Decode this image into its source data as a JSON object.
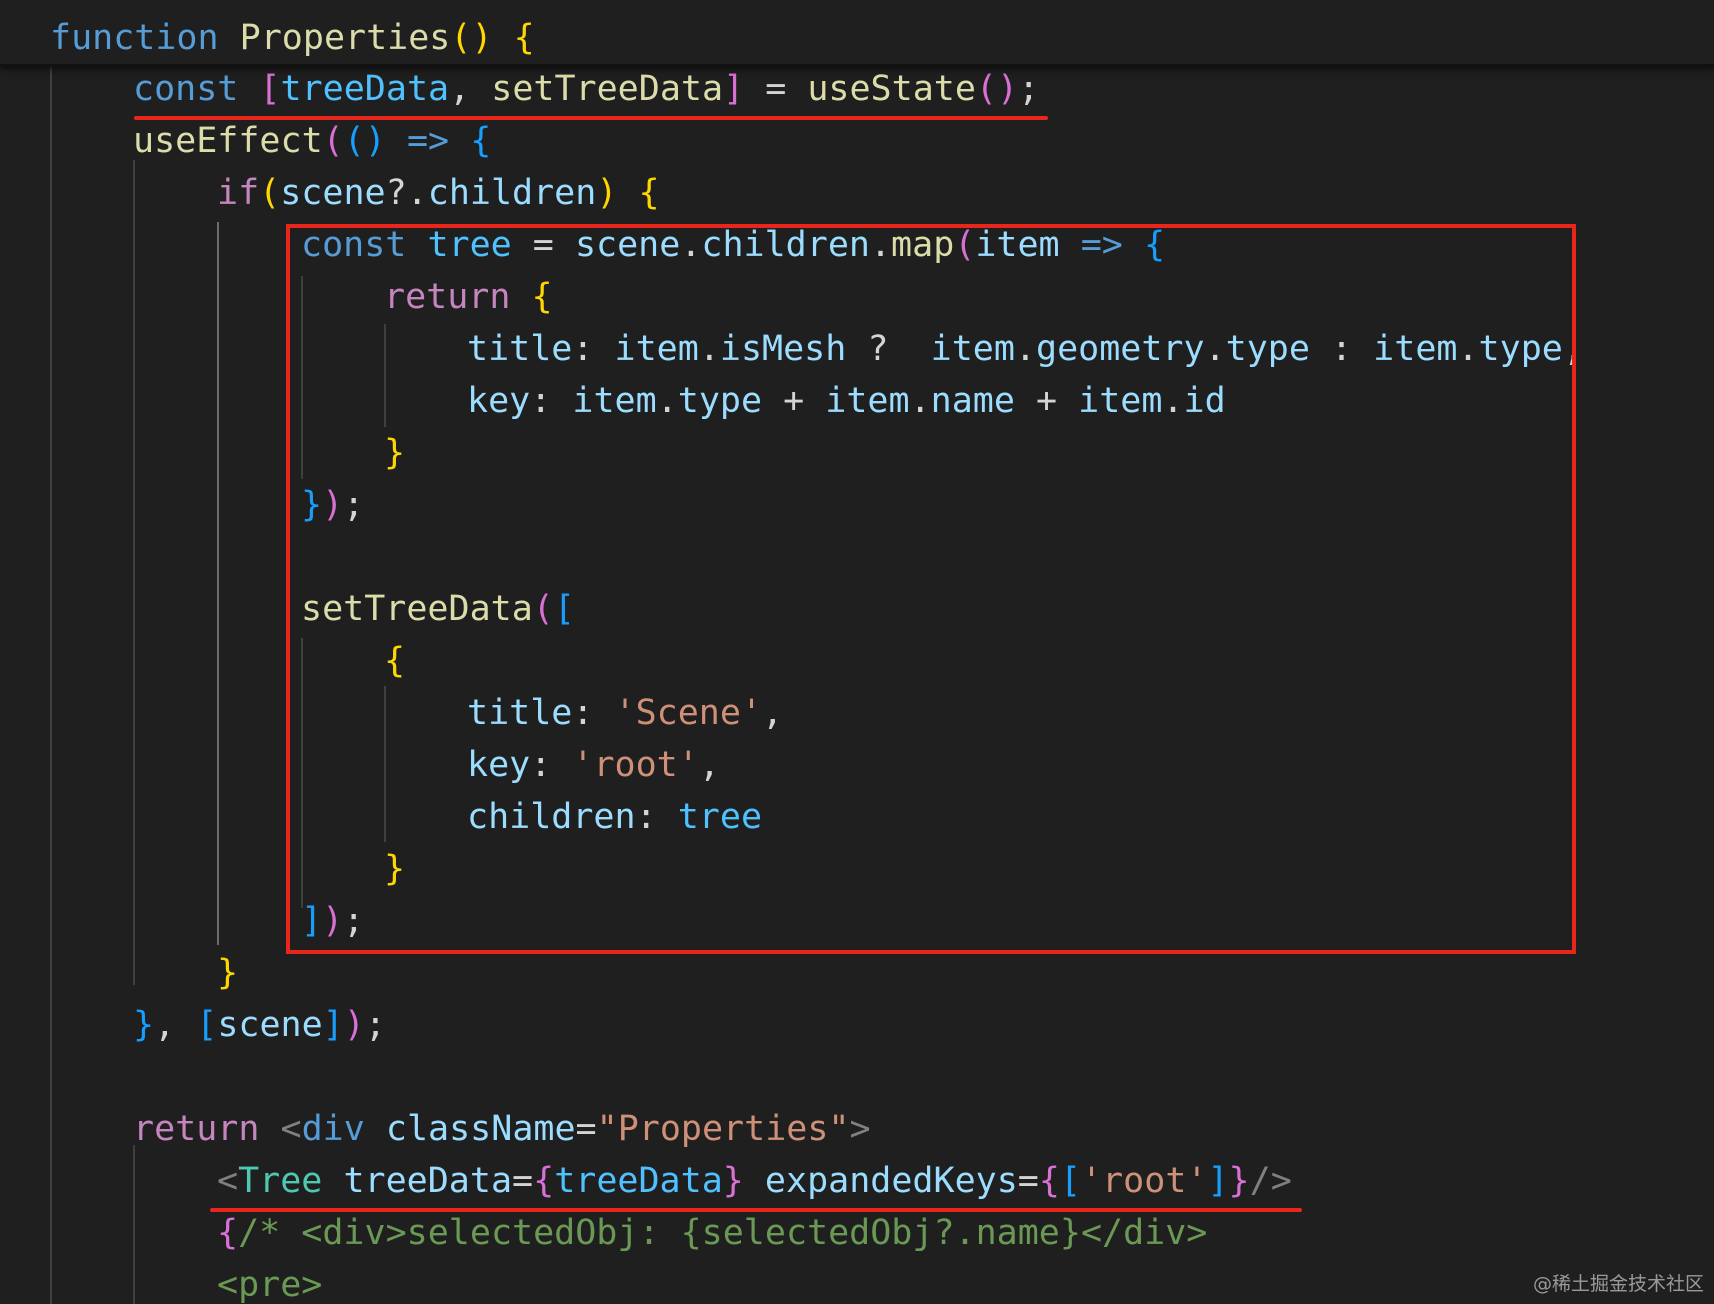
{
  "editor": {
    "theme": "dark",
    "colors": {
      "background": "#1f1f1f",
      "keyword": "#569cd6",
      "control": "#c586c0",
      "function": "#dcdcaa",
      "variable": "#9cdcfe",
      "constant": "#4fc1ff",
      "string": "#ce9178",
      "plain": "#d4d4d4",
      "bracket_1": "#ffd700",
      "bracket_2": "#da70d6",
      "bracket_3": "#179fff",
      "component_tag": "#4ec9b0",
      "html_tag": "#569cd6",
      "comment": "#6a9955",
      "annotation": "#e8261c"
    },
    "lines": [
      {
        "tokens": [
          {
            "t": "function",
            "c": "kw"
          },
          {
            "t": " ",
            "c": "pl"
          },
          {
            "t": "Properties",
            "c": "fn"
          },
          {
            "t": "()",
            "c": "b1"
          },
          {
            "t": " ",
            "c": "pl"
          },
          {
            "t": "{",
            "c": "b1"
          }
        ]
      },
      {
        "tokens": [
          {
            "t": "const",
            "c": "kw"
          },
          {
            "t": " ",
            "c": "pl"
          },
          {
            "t": "[",
            "c": "b2"
          },
          {
            "t": "treeData",
            "c": "cst"
          },
          {
            "t": ", ",
            "c": "pl"
          },
          {
            "t": "setTreeData",
            "c": "fn"
          },
          {
            "t": "]",
            "c": "b2"
          },
          {
            "t": " = ",
            "c": "pl"
          },
          {
            "t": "useState",
            "c": "fn"
          },
          {
            "t": "()",
            "c": "b2"
          },
          {
            "t": ";",
            "c": "pl"
          }
        ]
      },
      {
        "tokens": [
          {
            "t": "useEffect",
            "c": "fn"
          },
          {
            "t": "(",
            "c": "b2"
          },
          {
            "t": "()",
            "c": "b3"
          },
          {
            "t": " ",
            "c": "pl"
          },
          {
            "t": "=>",
            "c": "kw"
          },
          {
            "t": " ",
            "c": "pl"
          },
          {
            "t": "{",
            "c": "b3"
          }
        ]
      },
      {
        "tokens": [
          {
            "t": "if",
            "c": "ctl"
          },
          {
            "t": "(",
            "c": "b1"
          },
          {
            "t": "scene",
            "c": "var"
          },
          {
            "t": "?.",
            "c": "pl"
          },
          {
            "t": "children",
            "c": "var"
          },
          {
            "t": ")",
            "c": "b1"
          },
          {
            "t": " ",
            "c": "pl"
          },
          {
            "t": "{",
            "c": "b1"
          }
        ]
      },
      {
        "tokens": [
          {
            "t": "const",
            "c": "kw"
          },
          {
            "t": " ",
            "c": "pl"
          },
          {
            "t": "tree",
            "c": "cst"
          },
          {
            "t": " = ",
            "c": "pl"
          },
          {
            "t": "scene",
            "c": "var"
          },
          {
            "t": ".",
            "c": "pl"
          },
          {
            "t": "children",
            "c": "var"
          },
          {
            "t": ".",
            "c": "pl"
          },
          {
            "t": "map",
            "c": "fn"
          },
          {
            "t": "(",
            "c": "b2"
          },
          {
            "t": "item",
            "c": "var"
          },
          {
            "t": " ",
            "c": "pl"
          },
          {
            "t": "=>",
            "c": "kw"
          },
          {
            "t": " ",
            "c": "pl"
          },
          {
            "t": "{",
            "c": "b3"
          }
        ]
      },
      {
        "tokens": [
          {
            "t": "return",
            "c": "ctl"
          },
          {
            "t": " ",
            "c": "pl"
          },
          {
            "t": "{",
            "c": "b1"
          }
        ]
      },
      {
        "tokens": [
          {
            "t": "title",
            "c": "var"
          },
          {
            "t": ": ",
            "c": "pl"
          },
          {
            "t": "item",
            "c": "var"
          },
          {
            "t": ".",
            "c": "pl"
          },
          {
            "t": "isMesh",
            "c": "var"
          },
          {
            "t": " ?  ",
            "c": "pl"
          },
          {
            "t": "item",
            "c": "var"
          },
          {
            "t": ".",
            "c": "pl"
          },
          {
            "t": "geometry",
            "c": "var"
          },
          {
            "t": ".",
            "c": "pl"
          },
          {
            "t": "type",
            "c": "var"
          },
          {
            "t": " : ",
            "c": "pl"
          },
          {
            "t": "item",
            "c": "var"
          },
          {
            "t": ".",
            "c": "pl"
          },
          {
            "t": "type",
            "c": "var"
          },
          {
            "t": ",",
            "c": "pl"
          }
        ]
      },
      {
        "tokens": [
          {
            "t": "key",
            "c": "var"
          },
          {
            "t": ": ",
            "c": "pl"
          },
          {
            "t": "item",
            "c": "var"
          },
          {
            "t": ".",
            "c": "pl"
          },
          {
            "t": "type",
            "c": "var"
          },
          {
            "t": " + ",
            "c": "pl"
          },
          {
            "t": "item",
            "c": "var"
          },
          {
            "t": ".",
            "c": "pl"
          },
          {
            "t": "name",
            "c": "var"
          },
          {
            "t": " + ",
            "c": "pl"
          },
          {
            "t": "item",
            "c": "var"
          },
          {
            "t": ".",
            "c": "pl"
          },
          {
            "t": "id",
            "c": "var"
          }
        ]
      },
      {
        "tokens": [
          {
            "t": "}",
            "c": "b1"
          }
        ]
      },
      {
        "tokens": [
          {
            "t": "}",
            "c": "b3"
          },
          {
            "t": ")",
            "c": "b2"
          },
          {
            "t": ";",
            "c": "pl"
          }
        ]
      },
      {
        "tokens": []
      },
      {
        "tokens": [
          {
            "t": "setTreeData",
            "c": "fn"
          },
          {
            "t": "(",
            "c": "b2"
          },
          {
            "t": "[",
            "c": "b3"
          }
        ]
      },
      {
        "tokens": [
          {
            "t": "{",
            "c": "b1"
          }
        ]
      },
      {
        "tokens": [
          {
            "t": "title",
            "c": "var"
          },
          {
            "t": ": ",
            "c": "pl"
          },
          {
            "t": "'Scene'",
            "c": "str"
          },
          {
            "t": ",",
            "c": "pl"
          }
        ]
      },
      {
        "tokens": [
          {
            "t": "key",
            "c": "var"
          },
          {
            "t": ": ",
            "c": "pl"
          },
          {
            "t": "'root'",
            "c": "str"
          },
          {
            "t": ",",
            "c": "pl"
          }
        ]
      },
      {
        "tokens": [
          {
            "t": "children",
            "c": "var"
          },
          {
            "t": ": ",
            "c": "pl"
          },
          {
            "t": "tree",
            "c": "cst"
          }
        ]
      },
      {
        "tokens": [
          {
            "t": "}",
            "c": "b1"
          }
        ]
      },
      {
        "tokens": [
          {
            "t": "]",
            "c": "b3"
          },
          {
            "t": ")",
            "c": "b2"
          },
          {
            "t": ";",
            "c": "pl"
          }
        ]
      },
      {
        "tokens": [
          {
            "t": "}",
            "c": "b1"
          }
        ]
      },
      {
        "tokens": [
          {
            "t": "}",
            "c": "b3"
          },
          {
            "t": ", ",
            "c": "pl"
          },
          {
            "t": "[",
            "c": "b3"
          },
          {
            "t": "scene",
            "c": "var"
          },
          {
            "t": "]",
            "c": "b3"
          },
          {
            "t": ")",
            "c": "b2"
          },
          {
            "t": ";",
            "c": "pl"
          }
        ]
      },
      {
        "tokens": []
      },
      {
        "tokens": [
          {
            "t": "return",
            "c": "ctl"
          },
          {
            "t": " ",
            "c": "pl"
          },
          {
            "t": "<",
            "c": "ang"
          },
          {
            "t": "div",
            "c": "htm"
          },
          {
            "t": " ",
            "c": "pl"
          },
          {
            "t": "className",
            "c": "att"
          },
          {
            "t": "=",
            "c": "pl"
          },
          {
            "t": "\"Properties\"",
            "c": "str"
          },
          {
            "t": ">",
            "c": "ang"
          }
        ]
      },
      {
        "tokens": [
          {
            "t": "<",
            "c": "ang"
          },
          {
            "t": "Tree",
            "c": "tag"
          },
          {
            "t": " ",
            "c": "pl"
          },
          {
            "t": "treeData",
            "c": "att"
          },
          {
            "t": "=",
            "c": "pl"
          },
          {
            "t": "{",
            "c": "b2"
          },
          {
            "t": "treeData",
            "c": "cst"
          },
          {
            "t": "}",
            "c": "b2"
          },
          {
            "t": " ",
            "c": "pl"
          },
          {
            "t": "expandedKeys",
            "c": "att"
          },
          {
            "t": "=",
            "c": "pl"
          },
          {
            "t": "{",
            "c": "b2"
          },
          {
            "t": "[",
            "c": "b3"
          },
          {
            "t": "'root'",
            "c": "str"
          },
          {
            "t": "]",
            "c": "b3"
          },
          {
            "t": "}",
            "c": "b2"
          },
          {
            "t": "/>",
            "c": "ang"
          }
        ]
      },
      {
        "tokens": [
          {
            "t": "{",
            "c": "b2"
          },
          {
            "t": "/* <div>selectedObj: {selectedObj?.name}</div>",
            "c": "cmt"
          }
        ]
      },
      {
        "tokens": [
          {
            "t": "<pre>",
            "c": "cmt"
          }
        ]
      }
    ]
  },
  "watermark": "@稀土掘金技术社区"
}
